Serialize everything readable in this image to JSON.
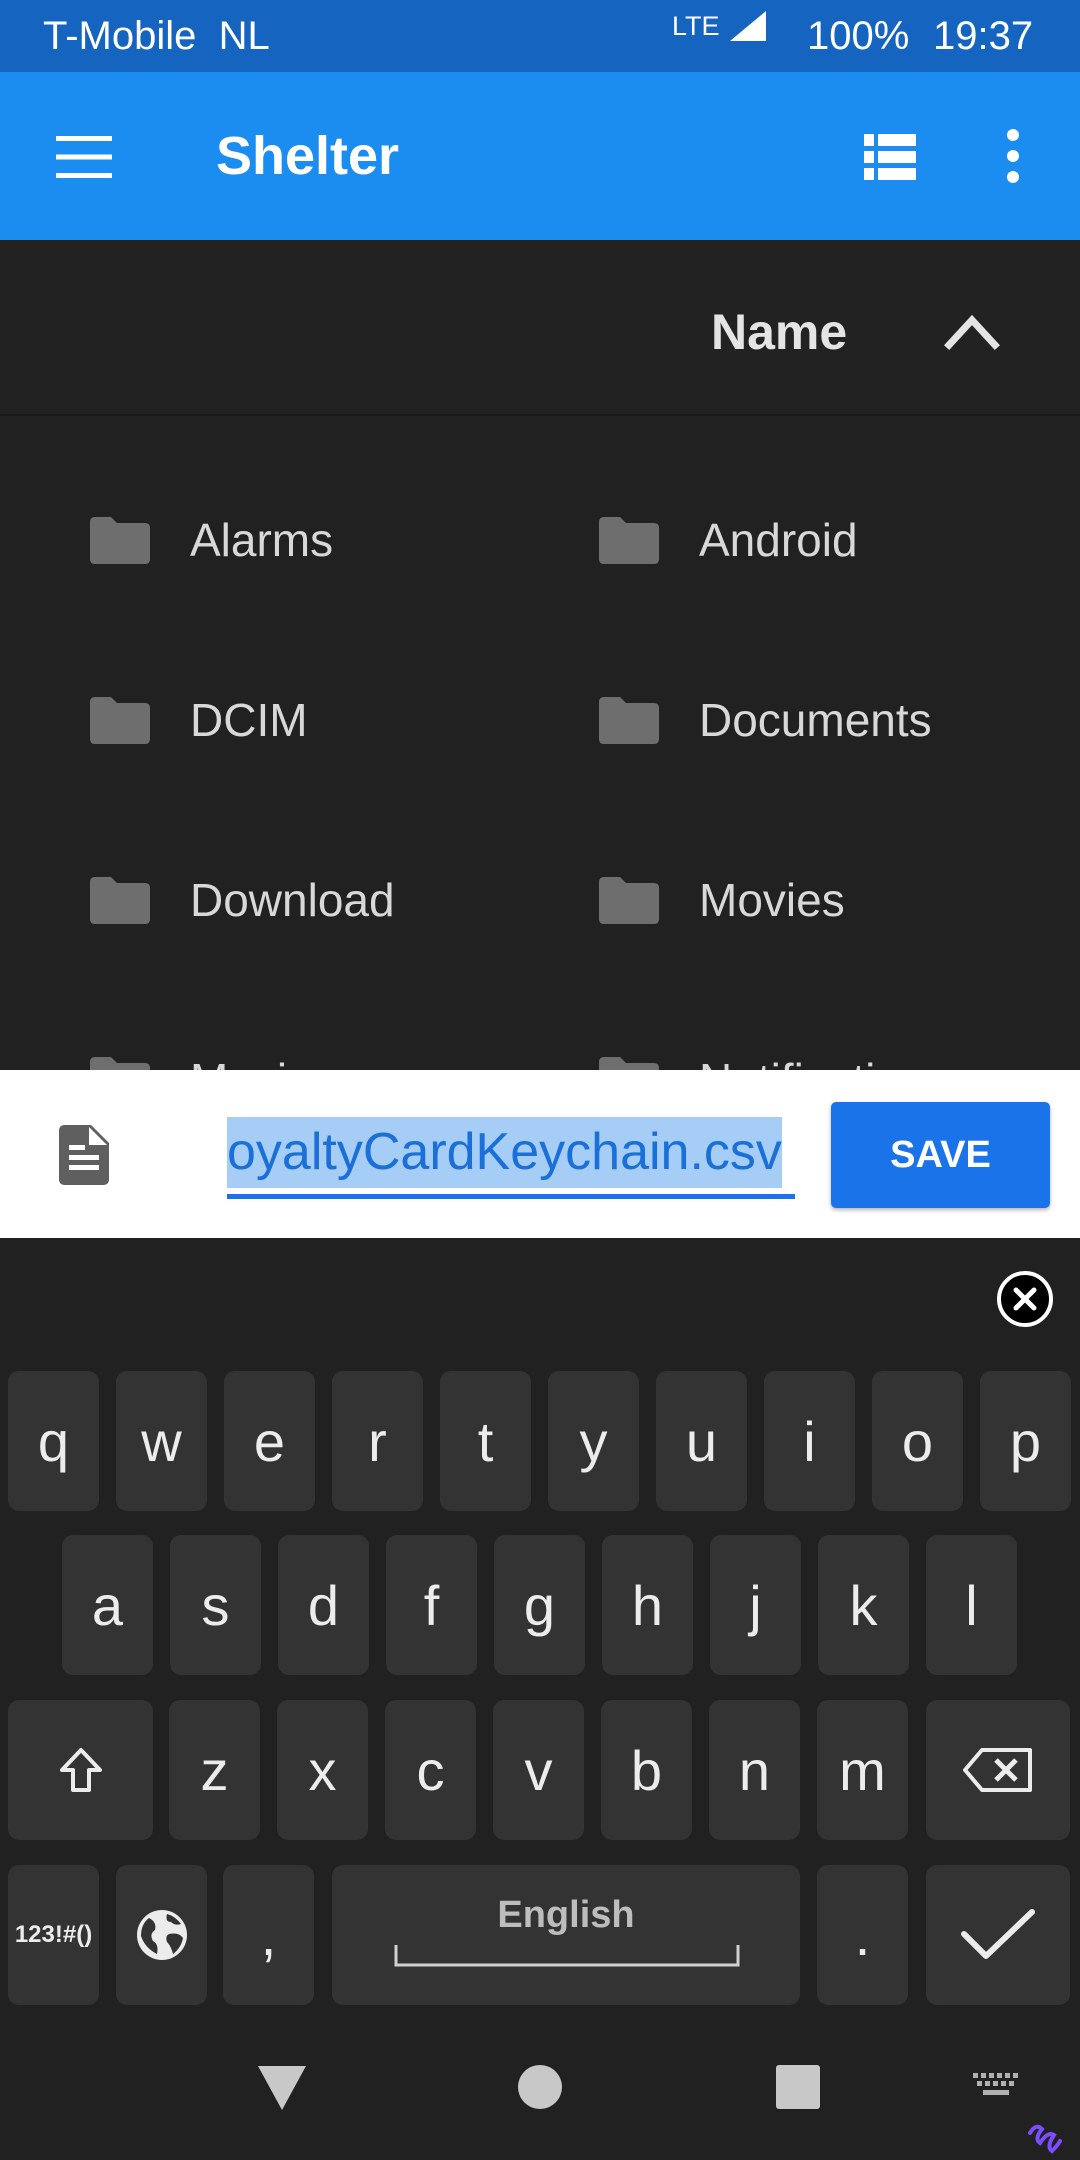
{
  "status_bar": {
    "carrier": "T-Mobile  NL",
    "network": "LTE",
    "battery": "100%",
    "time": "19:37",
    "icons": [
      "signal-icon"
    ]
  },
  "app_bar": {
    "title": "Shelter",
    "icons": [
      "menu-icon",
      "list-view-icon",
      "more-vert-icon"
    ]
  },
  "sort_header": {
    "label": "Name",
    "icon": "chevron-up-icon"
  },
  "folders": [
    {
      "name": "Alarms"
    },
    {
      "name": "Android"
    },
    {
      "name": "DCIM"
    },
    {
      "name": "Documents"
    },
    {
      "name": "Download"
    },
    {
      "name": "Movies"
    },
    {
      "name": "Music"
    },
    {
      "name": "Notifications"
    }
  ],
  "save_bar": {
    "icon": "document-icon",
    "filename": "oyaltyCardKeychain.csv",
    "save_label": "SAVE"
  },
  "keyboard": {
    "close_icon": "close-circle-icon",
    "rows": [
      [
        "q",
        "w",
        "e",
        "r",
        "t",
        "y",
        "u",
        "i",
        "o",
        "p"
      ],
      [
        "a",
        "s",
        "d",
        "f",
        "g",
        "h",
        "j",
        "k",
        "l"
      ],
      [
        "z",
        "x",
        "c",
        "v",
        "b",
        "n",
        "m"
      ]
    ],
    "symbols_label": "123!#()",
    "comma": ",",
    "period": ".",
    "space_label": "English",
    "icons": [
      "shift-icon",
      "backspace-icon",
      "globe-icon",
      "checkmark-icon"
    ]
  },
  "nav_bar": {
    "icons": [
      "back-icon",
      "home-icon",
      "recents-icon",
      "keyboard-icon",
      "brand-logo-icon"
    ]
  },
  "colors": {
    "status_bar": "#1565c0",
    "app_bar": "#1b8cf0",
    "background": "#212121",
    "key": "#333333",
    "accent": "#1a73e8",
    "selection": "#a5cdf5"
  }
}
